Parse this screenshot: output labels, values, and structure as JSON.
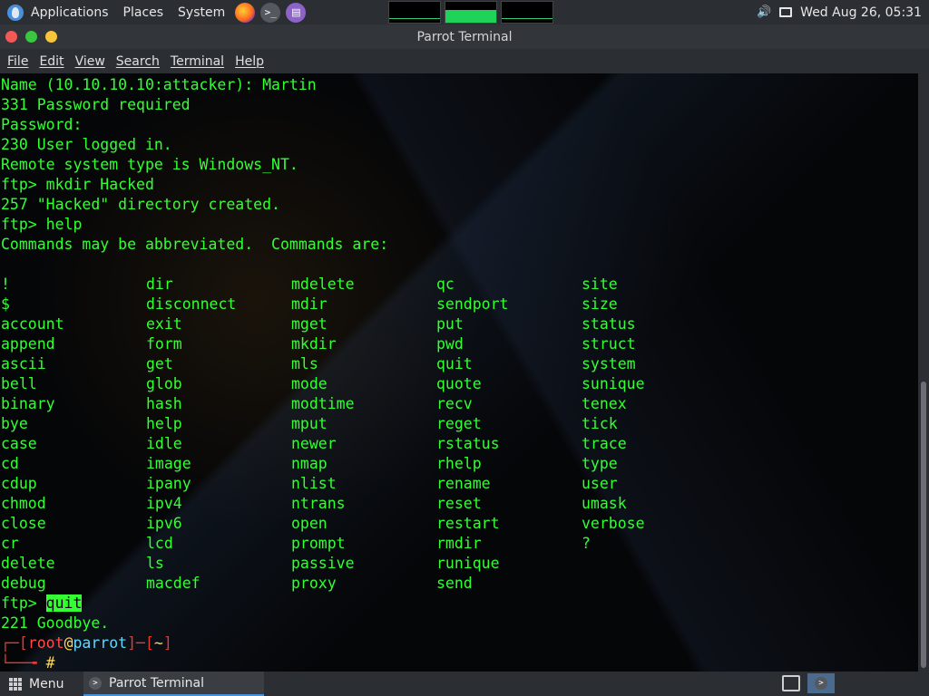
{
  "top_panel": {
    "applications": "Applications",
    "places": "Places",
    "system": "System",
    "datetime": "Wed Aug 26, 05:31",
    "icons": [
      "parrot-logo-icon",
      "firefox-icon",
      "terminal-launcher-icon",
      "notes-icon",
      "volume-icon",
      "screen-icon"
    ]
  },
  "window": {
    "title": "Parrot Terminal",
    "menu": [
      "File",
      "Edit",
      "View",
      "Search",
      "Terminal",
      "Help"
    ]
  },
  "terminal": {
    "lines_before": [
      "Name (10.10.10.10:attacker): Martin",
      "331 Password required",
      "Password:",
      "230 User logged in.",
      "Remote system type is Windows_NT.",
      "ftp> mkdir Hacked",
      "257 \"Hacked\" directory created.",
      "ftp> help",
      "Commands may be abbreviated.  Commands are:",
      ""
    ],
    "command_rows": [
      [
        "!",
        "dir",
        "mdelete",
        "qc",
        "site"
      ],
      [
        "$",
        "disconnect",
        "mdir",
        "sendport",
        "size"
      ],
      [
        "account",
        "exit",
        "mget",
        "put",
        "status"
      ],
      [
        "append",
        "form",
        "mkdir",
        "pwd",
        "struct"
      ],
      [
        "ascii",
        "get",
        "mls",
        "quit",
        "system"
      ],
      [
        "bell",
        "glob",
        "mode",
        "quote",
        "sunique"
      ],
      [
        "binary",
        "hash",
        "modtime",
        "recv",
        "tenex"
      ],
      [
        "bye",
        "help",
        "mput",
        "reget",
        "tick"
      ],
      [
        "case",
        "idle",
        "newer",
        "rstatus",
        "trace"
      ],
      [
        "cd",
        "image",
        "nmap",
        "rhelp",
        "type"
      ],
      [
        "cdup",
        "ipany",
        "nlist",
        "rename",
        "user"
      ],
      [
        "chmod",
        "ipv4",
        "ntrans",
        "reset",
        "umask"
      ],
      [
        "close",
        "ipv6",
        "open",
        "restart",
        "verbose"
      ],
      [
        "cr",
        "lcd",
        "prompt",
        "rmdir",
        "?"
      ],
      [
        "delete",
        "ls",
        "passive",
        "runique",
        ""
      ],
      [
        "debug",
        "macdef",
        "proxy",
        "send",
        ""
      ]
    ],
    "quit_prompt": "ftp> ",
    "quit_cmd": "quit",
    "goodbye": "221 Goodbye.",
    "prompt_open": "┌─[",
    "prompt_user": "root",
    "prompt_at": "@",
    "prompt_host": "parrot",
    "prompt_mid": "]─[",
    "prompt_dir": "~",
    "prompt_close": "]",
    "prompt2_prefix": "└──╼ ",
    "prompt2_hash": "#",
    "colors": {
      "text": "#33ff33",
      "background": "#050608",
      "prompt_bracket": "#e53935"
    }
  },
  "bottom_panel": {
    "menu_label": "Menu",
    "task_label": "Parrot Terminal"
  }
}
